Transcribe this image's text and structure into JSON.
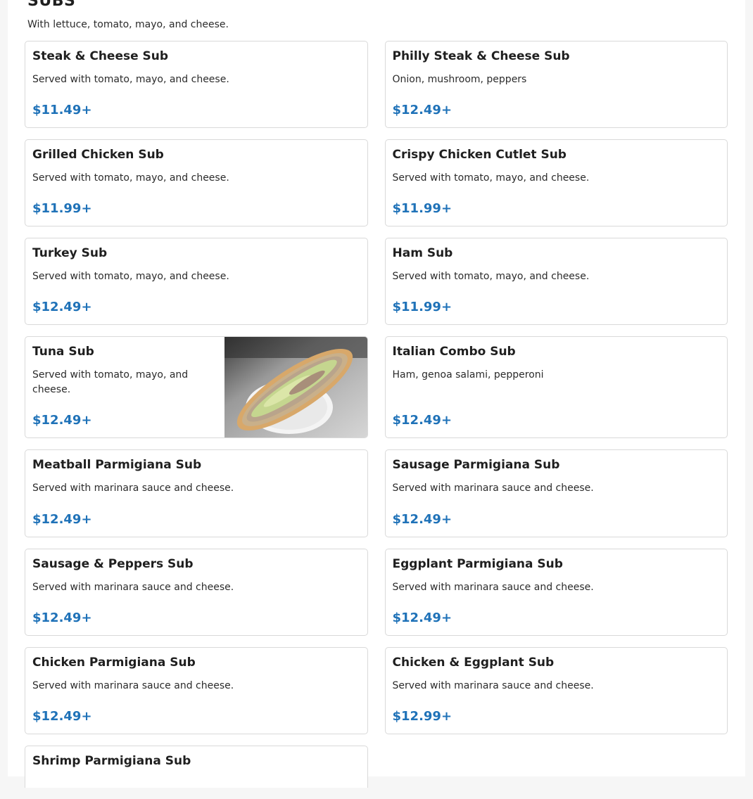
{
  "section": {
    "title": "SUBS",
    "description": "With lettuce, tomato, mayo, and cheese."
  },
  "colors": {
    "price": "#1f72b8",
    "border": "#d9d9d9"
  },
  "items": [
    {
      "name": "Steak & Cheese Sub",
      "description": "Served with tomato, mayo, and cheese.",
      "price": "$11.49+"
    },
    {
      "name": "Philly Steak & Cheese Sub",
      "description": "Onion, mushroom, peppers",
      "price": "$12.49+"
    },
    {
      "name": "Grilled Chicken Sub",
      "description": "Served with tomato, mayo, and cheese.",
      "price": "$11.99+"
    },
    {
      "name": "Crispy Chicken Cutlet Sub",
      "description": "Served with tomato, mayo, and cheese.",
      "price": "$11.99+"
    },
    {
      "name": "Turkey Sub",
      "description": "Served with tomato, mayo, and cheese.",
      "price": "$12.49+"
    },
    {
      "name": "Ham Sub",
      "description": "Served with tomato, mayo, and cheese.",
      "price": "$11.99+"
    },
    {
      "name": "Tuna Sub",
      "description": "Served with tomato, mayo, and cheese.",
      "price": "$12.49+",
      "image": "tuna-sub-photo"
    },
    {
      "name": "Italian Combo Sub",
      "description": "Ham, genoa salami, pepperoni",
      "price": "$12.49+"
    },
    {
      "name": "Meatball Parmigiana Sub",
      "description": "Served with marinara sauce and cheese.",
      "price": "$12.49+"
    },
    {
      "name": "Sausage Parmigiana Sub",
      "description": "Served with marinara sauce and cheese.",
      "price": "$12.49+"
    },
    {
      "name": "Sausage & Peppers Sub",
      "description": "Served with marinara sauce and cheese.",
      "price": "$12.49+"
    },
    {
      "name": "Eggplant Parmigiana Sub",
      "description": "Served with marinara sauce and cheese.",
      "price": "$12.49+"
    },
    {
      "name": "Chicken Parmigiana Sub",
      "description": "Served with marinara sauce and cheese.",
      "price": "$12.49+"
    },
    {
      "name": "Chicken & Eggplant Sub",
      "description": "Served with marinara sauce and cheese.",
      "price": "$12.99+"
    },
    {
      "name": "Shrimp Parmigiana Sub",
      "description": "",
      "price": ""
    }
  ]
}
